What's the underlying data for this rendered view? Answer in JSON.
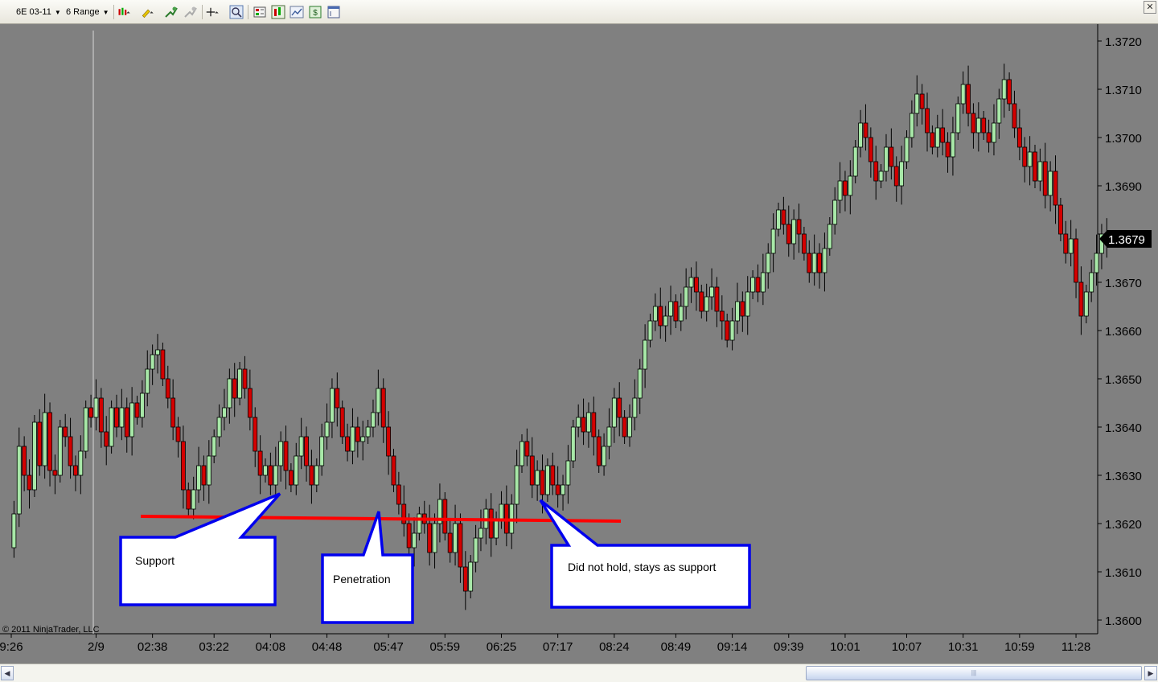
{
  "toolbar": {
    "instrument": "6E 03-11",
    "period": "6 Range",
    "icons": [
      "bar-type-icon",
      "drawing-pen-icon",
      "indicator-icon",
      "strategy-icon",
      "crosshair-icon",
      "zoom-icon",
      "data-box-icon",
      "chart-style-icon",
      "chart-trader-icon",
      "currency-icon",
      "window-properties-icon"
    ]
  },
  "colors": {
    "background": "#808080",
    "up_candle": "#a8e8a8",
    "down_candle": "#d40000",
    "support_line": "#ff0000",
    "callout_border": "#0000ee",
    "price_marker": "#000000"
  },
  "copyright": "© 2011 NinjaTrader, LLC",
  "chart_data": {
    "type": "candlestick",
    "instrument": "6E 03-11",
    "bar_type": "6 Range",
    "ylim": [
      1.3597,
      1.3724
    ],
    "y_ticks": [
      "1.3720",
      "1.3710",
      "1.3700",
      "1.3690",
      "1.3680",
      "1.3670",
      "1.3660",
      "1.3650",
      "1.3640",
      "1.3630",
      "1.3620",
      "1.3610",
      "1.3600"
    ],
    "x_ticks": [
      {
        "label": "9:26",
        "bar": 0
      },
      {
        "label": "2/9",
        "bar": 17
      },
      {
        "label": "02:38",
        "bar": 28
      },
      {
        "label": "03:22",
        "bar": 40
      },
      {
        "label": "04:08",
        "bar": 51
      },
      {
        "label": "04:48",
        "bar": 62
      },
      {
        "label": "05:47",
        "bar": 74
      },
      {
        "label": "05:59",
        "bar": 85
      },
      {
        "label": "06:25",
        "bar": 96
      },
      {
        "label": "07:17",
        "bar": 107
      },
      {
        "label": "08:24",
        "bar": 118
      },
      {
        "label": "08:49",
        "bar": 130
      },
      {
        "label": "09:14",
        "bar": 141
      },
      {
        "label": "09:39",
        "bar": 152
      },
      {
        "label": "10:01",
        "bar": 163
      },
      {
        "label": "10:07",
        "bar": 175
      },
      {
        "label": "10:31",
        "bar": 186
      },
      {
        "label": "10:59",
        "bar": 197
      },
      {
        "label": "11:28",
        "bar": 208
      }
    ],
    "session_break_bar": 17,
    "last_price": "1.3679",
    "closes": [
      1.3615,
      1.3622,
      1.3636,
      1.363,
      1.3627,
      1.3641,
      1.3632,
      1.3643,
      1.3631,
      1.363,
      1.364,
      1.3638,
      1.3632,
      1.363,
      1.3635,
      1.3644,
      1.3642,
      1.3646,
      1.3639,
      1.3636,
      1.3644,
      1.364,
      1.3644,
      1.3638,
      1.3645,
      1.3642,
      1.3647,
      1.3652,
      1.3655,
      1.3656,
      1.365,
      1.3646,
      1.364,
      1.3637,
      1.3627,
      1.3623,
      1.3627,
      1.3632,
      1.3628,
      1.3634,
      1.3638,
      1.3642,
      1.3644,
      1.365,
      1.3646,
      1.3652,
      1.3648,
      1.3642,
      1.3635,
      1.363,
      1.3632,
      1.3628,
      1.3632,
      1.3637,
      1.3631,
      1.3628,
      1.3634,
      1.3638,
      1.3632,
      1.3628,
      1.3632,
      1.3638,
      1.3641,
      1.3648,
      1.3644,
      1.3638,
      1.3635,
      1.364,
      1.3637,
      1.3638,
      1.364,
      1.3643,
      1.3648,
      1.364,
      1.3634,
      1.3628,
      1.3624,
      1.362,
      1.3615,
      1.3618,
      1.3622,
      1.362,
      1.3614,
      1.362,
      1.3625,
      1.3618,
      1.3614,
      1.362,
      1.3611,
      1.3606,
      1.3612,
      1.3617,
      1.3619,
      1.3623,
      1.3617,
      1.3621,
      1.3624,
      1.3618,
      1.3624,
      1.3632,
      1.3637,
      1.3634,
      1.3628,
      1.3631,
      1.3626,
      1.3632,
      1.3628,
      1.3626,
      1.3628,
      1.3633,
      1.364,
      1.3642,
      1.3639,
      1.3643,
      1.3638,
      1.3632,
      1.3636,
      1.364,
      1.3646,
      1.3642,
      1.3638,
      1.3642,
      1.3646,
      1.3652,
      1.3658,
      1.3662,
      1.3665,
      1.3661,
      1.3663,
      1.3666,
      1.3662,
      1.3665,
      1.3669,
      1.3671,
      1.3668,
      1.3664,
      1.3667,
      1.3669,
      1.3664,
      1.3662,
      1.3658,
      1.3662,
      1.3666,
      1.3663,
      1.3668,
      1.3671,
      1.3668,
      1.3672,
      1.3676,
      1.3681,
      1.3685,
      1.3682,
      1.3678,
      1.3683,
      1.368,
      1.3676,
      1.3672,
      1.3676,
      1.3672,
      1.3677,
      1.3682,
      1.3687,
      1.3691,
      1.3688,
      1.3692,
      1.3698,
      1.3703,
      1.37,
      1.3695,
      1.3691,
      1.3693,
      1.3698,
      1.3694,
      1.369,
      1.3695,
      1.37,
      1.3705,
      1.3709,
      1.3706,
      1.3701,
      1.3698,
      1.3702,
      1.3699,
      1.3696,
      1.3701,
      1.3707,
      1.3711,
      1.3705,
      1.3701,
      1.3704,
      1.3701,
      1.3699,
      1.3703,
      1.3708,
      1.3712,
      1.3707,
      1.3702,
      1.3698,
      1.3694,
      1.3697,
      1.3691,
      1.3695,
      1.3688,
      1.3693,
      1.3686,
      1.368,
      1.3676,
      1.3679,
      1.367,
      1.3663,
      1.3668,
      1.3672,
      1.3676,
      1.368,
      1.3679
    ]
  },
  "support_level": 1.3621,
  "annotations": [
    {
      "text": "Support"
    },
    {
      "text": "Penetration"
    },
    {
      "text": "Did not hold, stays as support"
    }
  ]
}
